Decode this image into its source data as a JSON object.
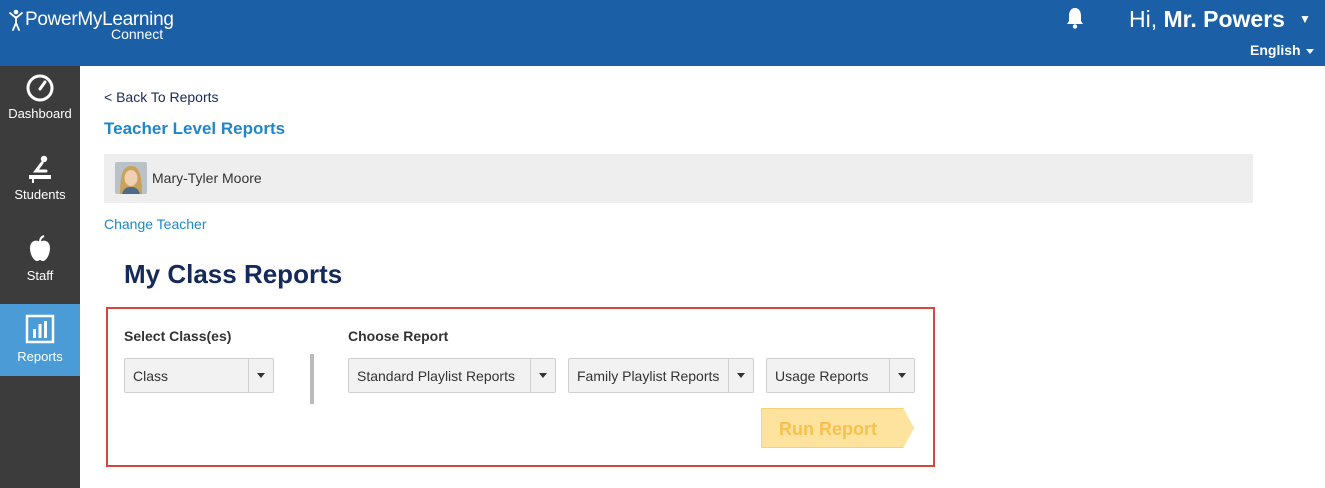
{
  "header": {
    "logo_main": "PowerMyLearning",
    "logo_sub": "Connect",
    "greeting_prefix": "Hi,",
    "user_name": "Mr. Powers",
    "language": "English"
  },
  "sidebar": {
    "items": [
      {
        "label": "Dashboard",
        "icon": "gauge-icon"
      },
      {
        "label": "Students",
        "icon": "student-desk-icon"
      },
      {
        "label": "Staff",
        "icon": "apple-icon"
      },
      {
        "label": "Reports",
        "icon": "bar-chart-icon",
        "active": true
      }
    ]
  },
  "main": {
    "back_link": "< Back To Reports",
    "section_title": "Teacher Level Reports",
    "teacher_name": "Mary-Tyler Moore",
    "change_teacher": "Change Teacher",
    "page_title": "My Class Reports",
    "select_class_label": "Select Class(es)",
    "class_select_value": "Class",
    "choose_report_label": "Choose Report",
    "report_selects": [
      "Standard Playlist Reports",
      "Family Playlist Reports",
      "Usage Reports"
    ],
    "run_report": "Run Report"
  },
  "colors": {
    "header_bg": "#1b5fa6",
    "sidebar_bg": "#3c3c3c",
    "sidebar_active": "#4a9bd6",
    "link_blue": "#1f87c9",
    "title_navy": "#152a5a",
    "panel_border": "#d9463e",
    "run_button_bg": "#fde39d"
  }
}
